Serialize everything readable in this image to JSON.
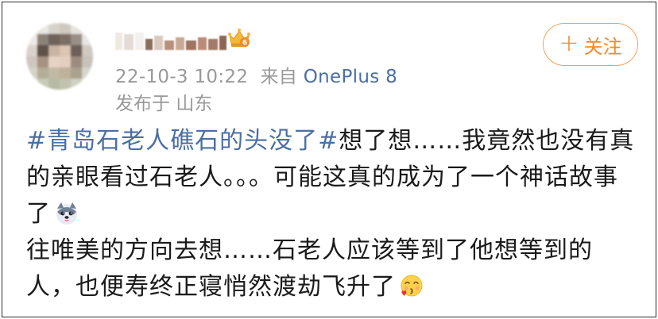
{
  "post": {
    "username_obscured": true,
    "timestamp": "22-10-3 10:22",
    "source_prefix": "来自",
    "source": "OnePlus 8",
    "location_prefix": "发布于",
    "location": "山东",
    "follow": {
      "plus": "+",
      "label": "关注"
    },
    "content": {
      "hashtag": "#青岛石老人礁石的头没了#",
      "text1": "想了想……我竟然也没有真的亲眼看过石老人。。。可能这真的成为了一个神话故事了",
      "emoji1": "husky-dog-emoji",
      "text2": "往唯美的方向去想……石老人应该等到了他想等到的人，也便寿终正寝悄然渡劫飞升了",
      "emoji2": "blowing-kiss-emoji"
    }
  },
  "colors": {
    "link": "#4a6fa5",
    "meta": "#999999",
    "follow_border": "#f0a35a",
    "follow_text": "#f08a2c",
    "text": "#1a1a1a"
  }
}
